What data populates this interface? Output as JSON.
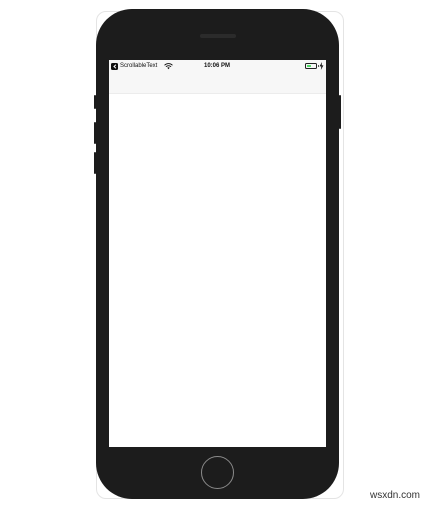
{
  "status_bar": {
    "back_app_label": "ScrollableText",
    "time": "10:06 PM",
    "battery_level_percent": 55,
    "battery_color": "#4cd964",
    "icons": {
      "back": "back-to-app-icon",
      "wifi": "wifi-icon",
      "battery": "battery-icon",
      "charging": "charging-bolt-icon"
    }
  },
  "navigation_bar": {
    "title": ""
  },
  "device": {
    "body_color": "#1c1c1c",
    "screen_color": "#ffffff"
  },
  "watermark": "wsxdn.com"
}
